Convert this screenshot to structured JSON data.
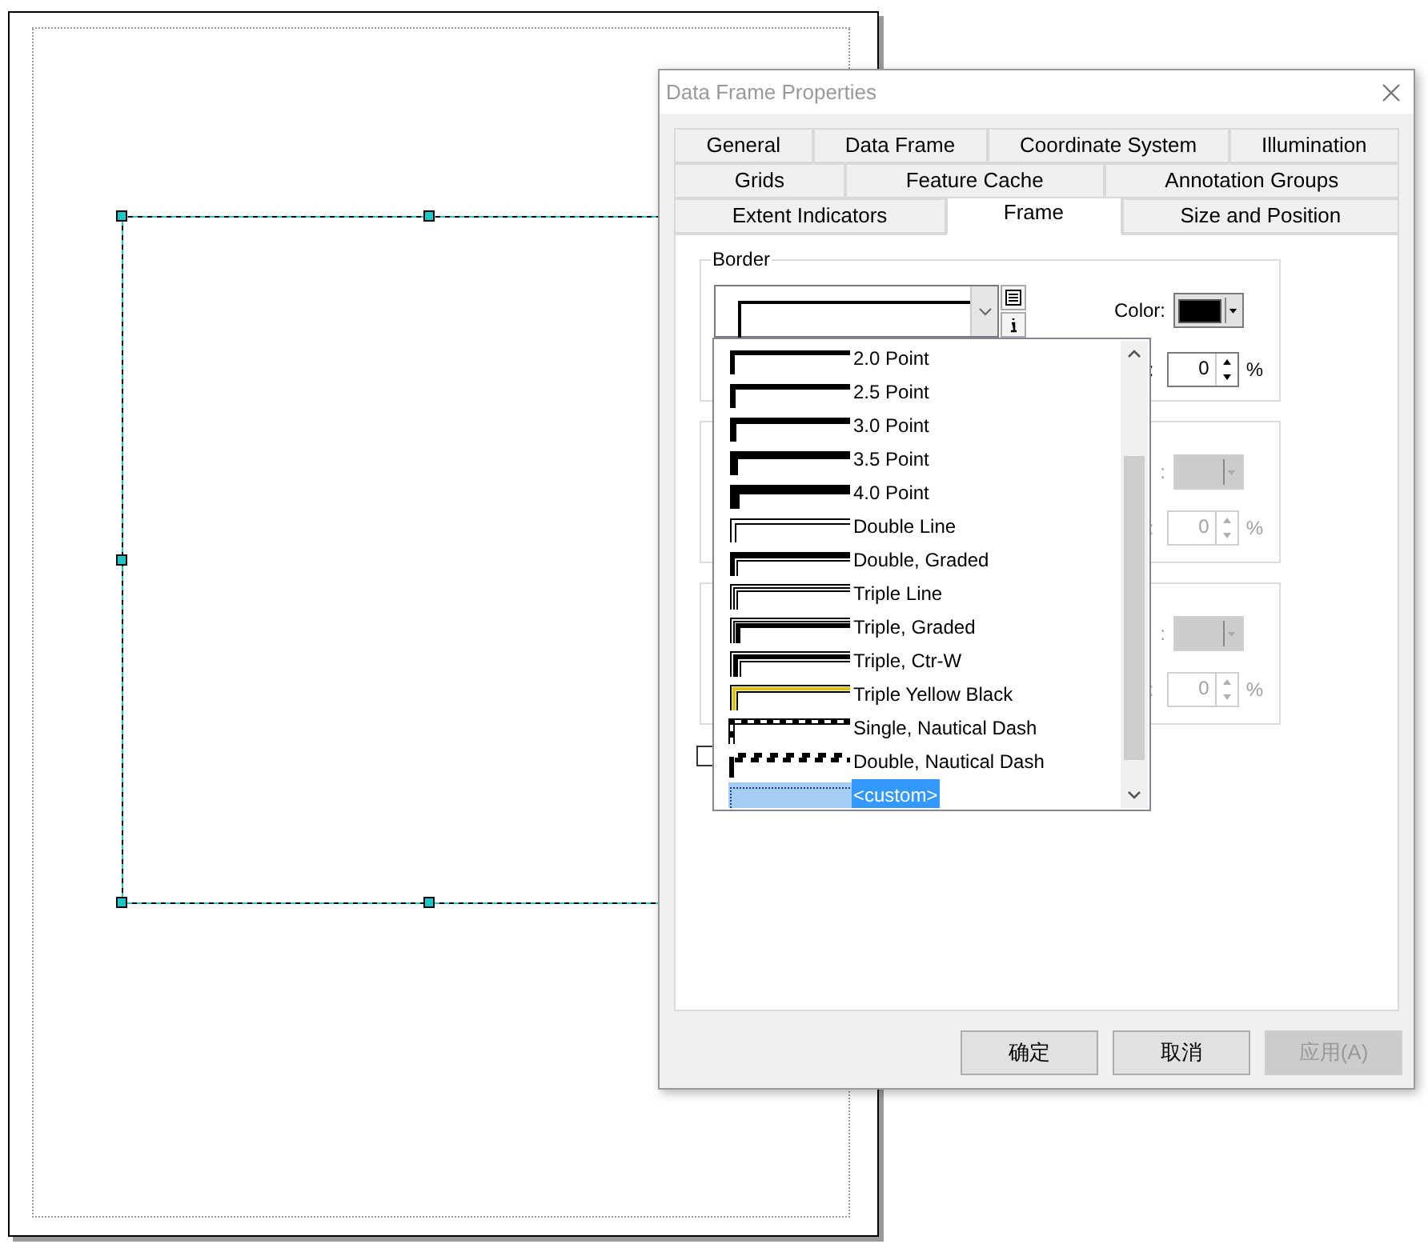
{
  "dialog": {
    "title": "Data Frame Properties",
    "tab_rows": [
      [
        {
          "label": "General",
          "selected": false
        },
        {
          "label": "Data Frame",
          "selected": false
        },
        {
          "label": "Coordinate System",
          "selected": false
        },
        {
          "label": "Illumination",
          "selected": false
        }
      ],
      [
        {
          "label": "Grids",
          "selected": false
        },
        {
          "label": "Feature Cache",
          "selected": false
        },
        {
          "label": "Annotation Groups",
          "selected": false
        }
      ],
      [
        {
          "label": "Extent Indicators",
          "selected": false
        },
        {
          "label": "Frame",
          "selected": true
        },
        {
          "label": "Size and Position",
          "selected": false
        }
      ]
    ],
    "groups": [
      {
        "kind": "border",
        "title": "Border",
        "color_label": "Color:",
        "gap_label": ":",
        "gap_value": "0",
        "gap_unit": "%",
        "disabled": false
      },
      {
        "kind": "plain",
        "color_label": ":",
        "gap_label": ":",
        "gap_value": "0",
        "gap_unit": "%",
        "disabled": true
      },
      {
        "kind": "plain",
        "color_label": ":",
        "gap_label": ":",
        "gap_value": "0",
        "gap_unit": "%",
        "disabled": true
      }
    ],
    "checkbox": {
      "checked": false
    },
    "dropdown_list": {
      "items": [
        {
          "label": "2.0 Point",
          "kind": "point20",
          "selected": false
        },
        {
          "label": "2.5 Point",
          "kind": "point25",
          "selected": false
        },
        {
          "label": "3.0 Point",
          "kind": "point30",
          "selected": false
        },
        {
          "label": "3.5 Point",
          "kind": "point35",
          "selected": false
        },
        {
          "label": "4.0 Point",
          "kind": "point40",
          "selected": false
        },
        {
          "label": "Double Line",
          "kind": "double",
          "selected": false
        },
        {
          "label": "Double, Graded",
          "kind": "doublegraded",
          "selected": false
        },
        {
          "label": "Triple Line",
          "kind": "triple",
          "selected": false
        },
        {
          "label": "Triple, Graded",
          "kind": "triplegraded",
          "selected": false
        },
        {
          "label": "Triple, Ctr-W",
          "kind": "triplectrw",
          "selected": false
        },
        {
          "label": "Triple Yellow Black",
          "kind": "tripleyellow",
          "selected": false
        },
        {
          "label": "Single, Nautical Dash",
          "kind": "nautical",
          "selected": false
        },
        {
          "label": "Double, Nautical Dash",
          "kind": "nauticaldouble",
          "selected": false
        },
        {
          "label": "<custom>",
          "kind": "custom",
          "selected": true
        }
      ]
    },
    "buttons": [
      {
        "label": "确定",
        "disabled": false
      },
      {
        "label": "取消",
        "disabled": false
      },
      {
        "label": "应用(A)",
        "disabled": true
      }
    ]
  }
}
